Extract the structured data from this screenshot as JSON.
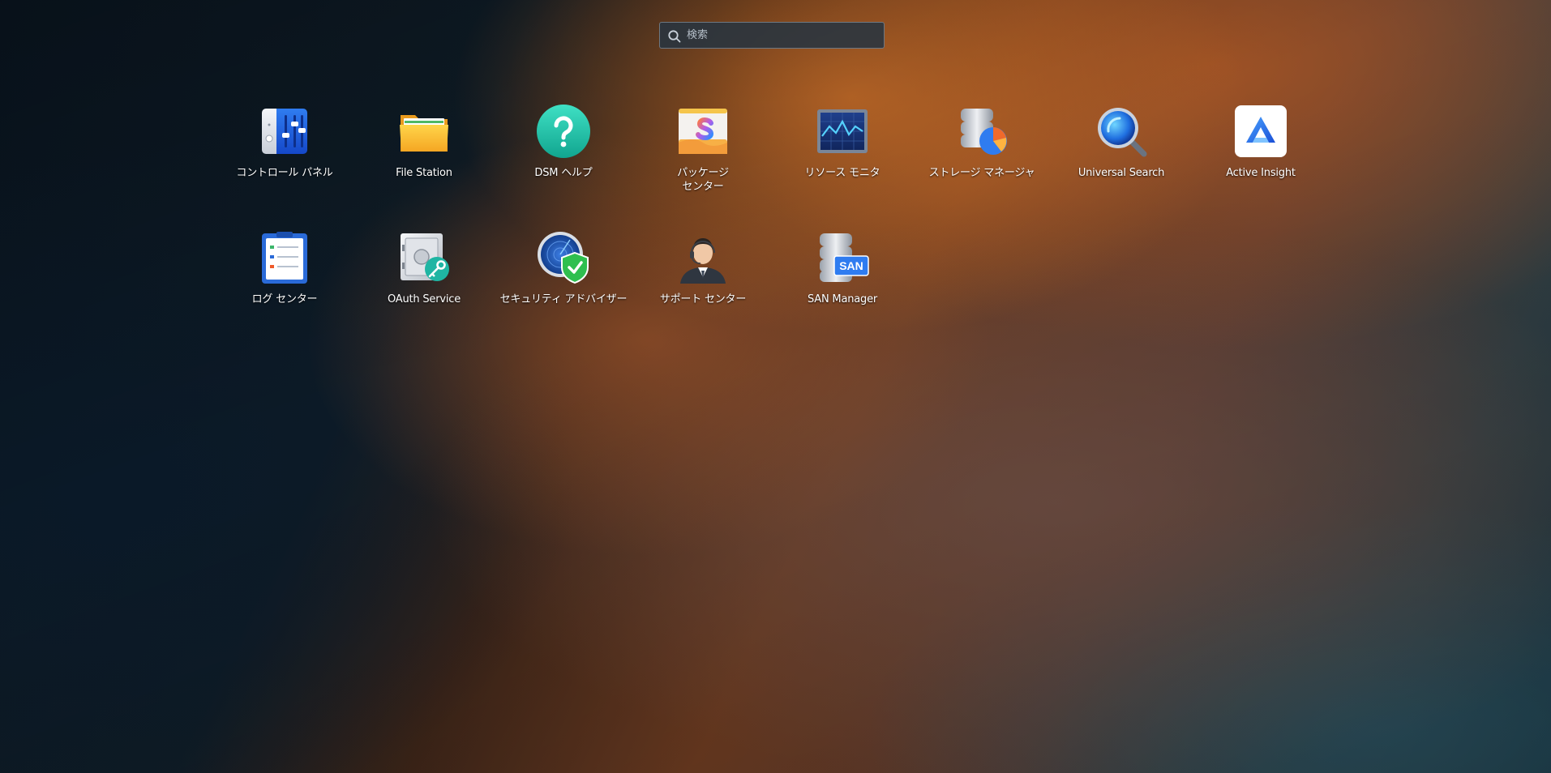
{
  "search": {
    "placeholder": "検索",
    "value": ""
  },
  "apps": [
    {
      "name": "control-panel",
      "label": "コントロール パネル",
      "icon": "control-panel-icon"
    },
    {
      "name": "file-station",
      "label": "File Station",
      "icon": "folder-icon"
    },
    {
      "name": "dsm-help",
      "label": "DSM ヘルプ",
      "icon": "help-icon"
    },
    {
      "name": "package-center",
      "label": "パッケージ\nセンター",
      "icon": "package-icon"
    },
    {
      "name": "resource-monitor",
      "label": "リソース モニタ",
      "icon": "monitor-icon"
    },
    {
      "name": "storage-manager",
      "label": "ストレージ マネージャ",
      "icon": "storage-icon"
    },
    {
      "name": "universal-search",
      "label": "Universal Search",
      "icon": "magnifier-icon"
    },
    {
      "name": "active-insight",
      "label": "Active Insight",
      "icon": "active-insight-icon"
    },
    {
      "name": "log-center",
      "label": "ログ センター",
      "icon": "log-icon"
    },
    {
      "name": "oauth-service",
      "label": "OAuth Service",
      "icon": "safe-key-icon"
    },
    {
      "name": "security-advisor",
      "label": "セキュリティ アドバイザー",
      "icon": "shield-radar-icon"
    },
    {
      "name": "support-center",
      "label": "サポート センター",
      "icon": "support-agent-icon"
    },
    {
      "name": "san-manager",
      "label": "SAN Manager",
      "icon": "san-icon"
    }
  ]
}
